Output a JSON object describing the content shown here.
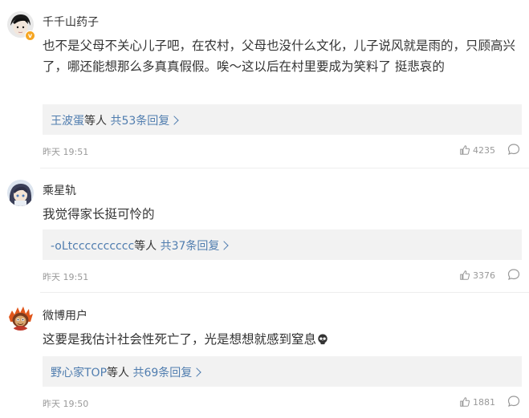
{
  "comments": [
    {
      "username": "千千山药子",
      "verified": true,
      "text": "也不是父母不关心儿子吧，在农村，父母也没什么文化，儿子说风就是雨的，只顾高兴了，哪还能想那么多真真假假。唉～这以后在村里要成为笑料了 挺悲哀的",
      "reply_user": "王波蛋",
      "reply_mid": "等人",
      "reply_count": "共53条回复",
      "time": "昨天 19:51",
      "likes": "4235"
    },
    {
      "username": "乘星轨",
      "verified": false,
      "text": "我觉得家长挺可怜的",
      "reply_user": "-oLtcccccccccc",
      "reply_mid": "等人",
      "reply_count": "共37条回复",
      "time": "昨天 19:51",
      "likes": "3376"
    },
    {
      "username": "微博用户",
      "verified": false,
      "text": "这要是我估计社会性死亡了，光是想想就感到窒息",
      "reply_user": "野心家TOP",
      "reply_mid": "等人",
      "reply_count": "共69条回复",
      "time": "昨天 19:50",
      "likes": "1881"
    }
  ],
  "colors": {
    "link": "#507daf",
    "meta": "#999999",
    "reply_bg": "#f2f2f2",
    "badge": "#f6a623"
  },
  "icons": [
    "like-icon",
    "comment-icon",
    "verified-badge-icon",
    "skull-emoji-icon"
  ]
}
